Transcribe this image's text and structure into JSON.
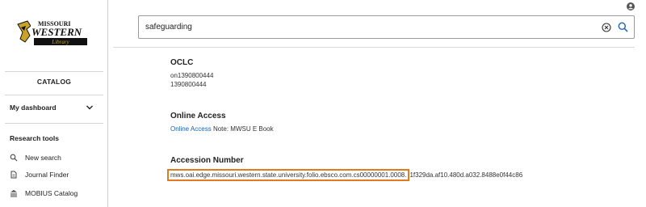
{
  "sidebar": {
    "logo": {
      "line1": "MISSOURI",
      "line2": "WESTERN",
      "line3": "Library"
    },
    "catalog_label": "CATALOG",
    "dashboard_label": "My dashboard",
    "research_heading": "Research tools",
    "items": [
      {
        "label": "New search",
        "icon": "search-icon"
      },
      {
        "label": "Journal Finder",
        "icon": "document-icon"
      },
      {
        "label": "MOBIUS Catalog",
        "icon": "library-icon"
      }
    ]
  },
  "search": {
    "value": "safeguarding",
    "clear_icon": "clear-circle-icon",
    "submit_icon": "search-icon"
  },
  "record": {
    "oclc": {
      "title": "OCLC",
      "values": [
        "on1390800444",
        "1390800444"
      ]
    },
    "online_access": {
      "title": "Online Access",
      "link": "Online Access",
      "note": "Note: MWSU E Book"
    },
    "accession": {
      "title": "Accession Number",
      "highlighted": "mws.oai.edge.missouri.western.state.university.folio.ebsco.com.cs00000001.0008.",
      "rest": "1f329da.af10.480d.a032.8488e0f44c86"
    }
  },
  "colors": {
    "highlight": "#e07b1f",
    "link": "#1f5fa8",
    "logo_gold": "#c9a227"
  }
}
